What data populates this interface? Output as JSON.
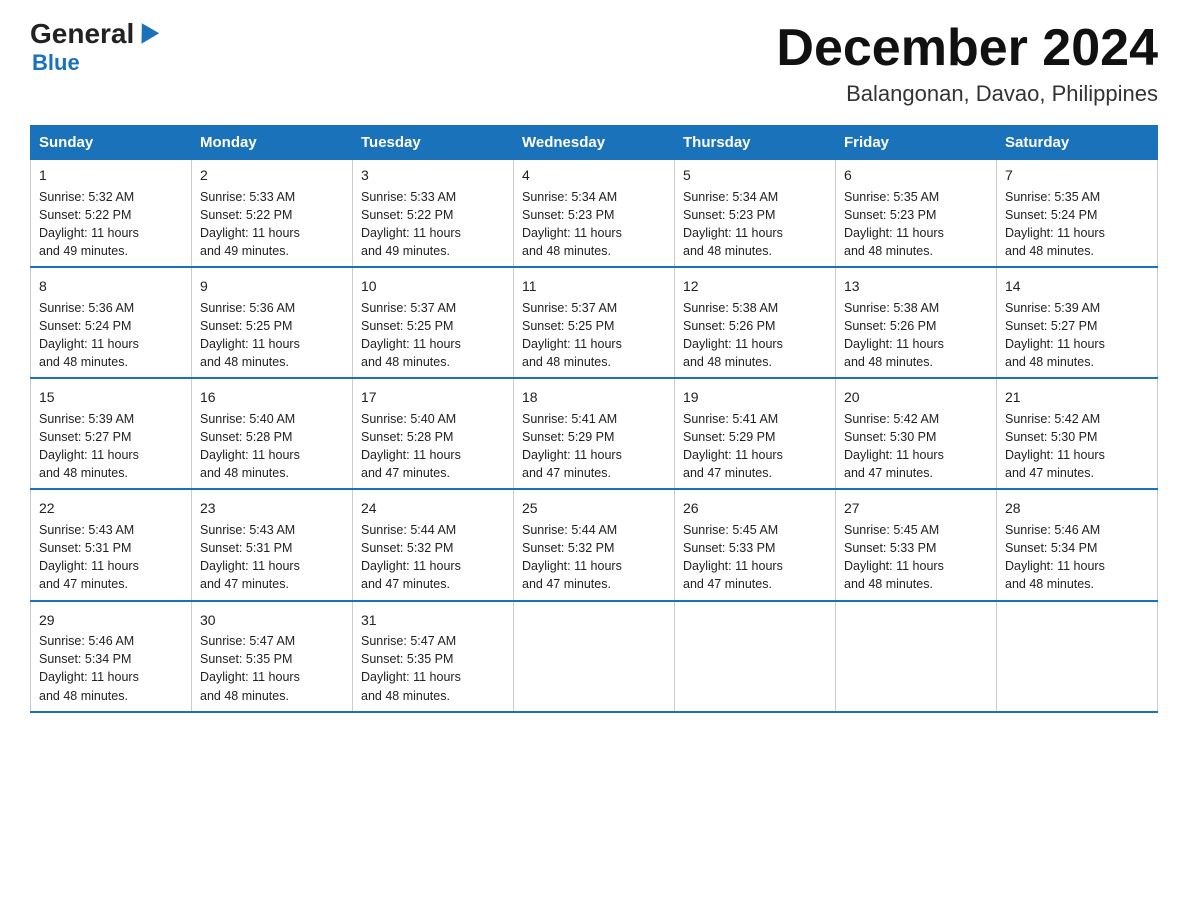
{
  "logo": {
    "general": "General",
    "blue": "Blue"
  },
  "title": "December 2024",
  "subtitle": "Balangonan, Davao, Philippines",
  "columns": [
    "Sunday",
    "Monday",
    "Tuesday",
    "Wednesday",
    "Thursday",
    "Friday",
    "Saturday"
  ],
  "weeks": [
    [
      {
        "day": "1",
        "info": "Sunrise: 5:32 AM\nSunset: 5:22 PM\nDaylight: 11 hours\nand 49 minutes."
      },
      {
        "day": "2",
        "info": "Sunrise: 5:33 AM\nSunset: 5:22 PM\nDaylight: 11 hours\nand 49 minutes."
      },
      {
        "day": "3",
        "info": "Sunrise: 5:33 AM\nSunset: 5:22 PM\nDaylight: 11 hours\nand 49 minutes."
      },
      {
        "day": "4",
        "info": "Sunrise: 5:34 AM\nSunset: 5:23 PM\nDaylight: 11 hours\nand 48 minutes."
      },
      {
        "day": "5",
        "info": "Sunrise: 5:34 AM\nSunset: 5:23 PM\nDaylight: 11 hours\nand 48 minutes."
      },
      {
        "day": "6",
        "info": "Sunrise: 5:35 AM\nSunset: 5:23 PM\nDaylight: 11 hours\nand 48 minutes."
      },
      {
        "day": "7",
        "info": "Sunrise: 5:35 AM\nSunset: 5:24 PM\nDaylight: 11 hours\nand 48 minutes."
      }
    ],
    [
      {
        "day": "8",
        "info": "Sunrise: 5:36 AM\nSunset: 5:24 PM\nDaylight: 11 hours\nand 48 minutes."
      },
      {
        "day": "9",
        "info": "Sunrise: 5:36 AM\nSunset: 5:25 PM\nDaylight: 11 hours\nand 48 minutes."
      },
      {
        "day": "10",
        "info": "Sunrise: 5:37 AM\nSunset: 5:25 PM\nDaylight: 11 hours\nand 48 minutes."
      },
      {
        "day": "11",
        "info": "Sunrise: 5:37 AM\nSunset: 5:25 PM\nDaylight: 11 hours\nand 48 minutes."
      },
      {
        "day": "12",
        "info": "Sunrise: 5:38 AM\nSunset: 5:26 PM\nDaylight: 11 hours\nand 48 minutes."
      },
      {
        "day": "13",
        "info": "Sunrise: 5:38 AM\nSunset: 5:26 PM\nDaylight: 11 hours\nand 48 minutes."
      },
      {
        "day": "14",
        "info": "Sunrise: 5:39 AM\nSunset: 5:27 PM\nDaylight: 11 hours\nand 48 minutes."
      }
    ],
    [
      {
        "day": "15",
        "info": "Sunrise: 5:39 AM\nSunset: 5:27 PM\nDaylight: 11 hours\nand 48 minutes."
      },
      {
        "day": "16",
        "info": "Sunrise: 5:40 AM\nSunset: 5:28 PM\nDaylight: 11 hours\nand 48 minutes."
      },
      {
        "day": "17",
        "info": "Sunrise: 5:40 AM\nSunset: 5:28 PM\nDaylight: 11 hours\nand 47 minutes."
      },
      {
        "day": "18",
        "info": "Sunrise: 5:41 AM\nSunset: 5:29 PM\nDaylight: 11 hours\nand 47 minutes."
      },
      {
        "day": "19",
        "info": "Sunrise: 5:41 AM\nSunset: 5:29 PM\nDaylight: 11 hours\nand 47 minutes."
      },
      {
        "day": "20",
        "info": "Sunrise: 5:42 AM\nSunset: 5:30 PM\nDaylight: 11 hours\nand 47 minutes."
      },
      {
        "day": "21",
        "info": "Sunrise: 5:42 AM\nSunset: 5:30 PM\nDaylight: 11 hours\nand 47 minutes."
      }
    ],
    [
      {
        "day": "22",
        "info": "Sunrise: 5:43 AM\nSunset: 5:31 PM\nDaylight: 11 hours\nand 47 minutes."
      },
      {
        "day": "23",
        "info": "Sunrise: 5:43 AM\nSunset: 5:31 PM\nDaylight: 11 hours\nand 47 minutes."
      },
      {
        "day": "24",
        "info": "Sunrise: 5:44 AM\nSunset: 5:32 PM\nDaylight: 11 hours\nand 47 minutes."
      },
      {
        "day": "25",
        "info": "Sunrise: 5:44 AM\nSunset: 5:32 PM\nDaylight: 11 hours\nand 47 minutes."
      },
      {
        "day": "26",
        "info": "Sunrise: 5:45 AM\nSunset: 5:33 PM\nDaylight: 11 hours\nand 47 minutes."
      },
      {
        "day": "27",
        "info": "Sunrise: 5:45 AM\nSunset: 5:33 PM\nDaylight: 11 hours\nand 48 minutes."
      },
      {
        "day": "28",
        "info": "Sunrise: 5:46 AM\nSunset: 5:34 PM\nDaylight: 11 hours\nand 48 minutes."
      }
    ],
    [
      {
        "day": "29",
        "info": "Sunrise: 5:46 AM\nSunset: 5:34 PM\nDaylight: 11 hours\nand 48 minutes."
      },
      {
        "day": "30",
        "info": "Sunrise: 5:47 AM\nSunset: 5:35 PM\nDaylight: 11 hours\nand 48 minutes."
      },
      {
        "day": "31",
        "info": "Sunrise: 5:47 AM\nSunset: 5:35 PM\nDaylight: 11 hours\nand 48 minutes."
      },
      {
        "day": "",
        "info": ""
      },
      {
        "day": "",
        "info": ""
      },
      {
        "day": "",
        "info": ""
      },
      {
        "day": "",
        "info": ""
      }
    ]
  ]
}
